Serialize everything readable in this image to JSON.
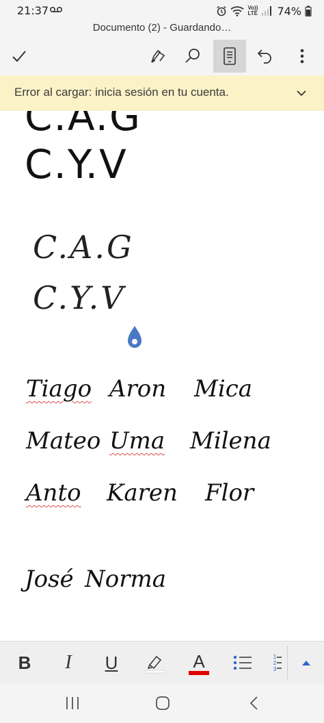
{
  "status_bar": {
    "time": "21:37",
    "battery_percent": "74%",
    "icons": [
      "voicemail-icon",
      "alarm-icon",
      "wifi-icon",
      "volte-icon",
      "signal-icon",
      "battery-icon"
    ],
    "volte_label_top": "Vo))",
    "volte_label_bottom": "LTE"
  },
  "header": {
    "document_title": "Documento (2) - Guardando…"
  },
  "toolbar": {
    "buttons": [
      {
        "name": "done",
        "icon": "checkmark-icon"
      },
      {
        "name": "draw",
        "icon": "pen-icon"
      },
      {
        "name": "find",
        "icon": "search-icon"
      },
      {
        "name": "mobile-view",
        "icon": "mobile-view-icon",
        "active": true
      },
      {
        "name": "undo",
        "icon": "undo-icon"
      },
      {
        "name": "more",
        "icon": "more-vertical-icon"
      }
    ]
  },
  "banner": {
    "message": "Error al cargar: inicia sesión en tu cuenta.",
    "icon": "chevron-down-icon",
    "background": "#fbf2c8"
  },
  "document": {
    "print_lines": [
      "C.A.G",
      "C.Y.V"
    ],
    "script_initials": [
      "C.A.G",
      "C.Y.V"
    ],
    "script_rows": [
      [
        "Tiago",
        "Aron",
        "Mica"
      ],
      [
        "Mateo",
        "Uma",
        "Milena"
      ],
      [
        "Anto",
        "Karen",
        "Flor"
      ],
      [
        "José",
        "Norma"
      ]
    ],
    "spellcheck_flagged": [
      "Tiago",
      "Uma",
      "Anto"
    ]
  },
  "format_bar": {
    "bold_label": "B",
    "italic_label": "I",
    "underline_label": "U",
    "font_color_label": "A",
    "font_color": "#e00000",
    "highlight_color": "#ffffff",
    "numbered_list_digits": [
      "1",
      "2",
      "3"
    ],
    "icons": [
      "highlighter-icon",
      "bullet-list-icon",
      "numbered-list-icon",
      "expand-up-icon"
    ]
  },
  "nav_bar": {
    "icons": [
      "recent-apps-icon",
      "home-icon",
      "back-icon"
    ]
  }
}
